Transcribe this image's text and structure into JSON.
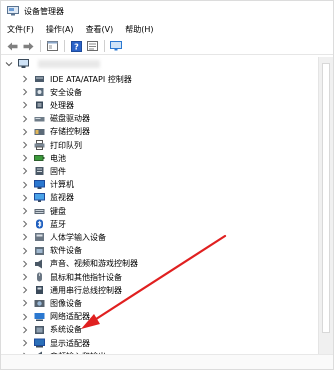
{
  "window": {
    "title": "设备管理器"
  },
  "menu": {
    "items": [
      "文件(F)",
      "操作(A)",
      "查看(V)",
      "帮助(H)"
    ]
  },
  "tree": {
    "items": [
      {
        "label": "IDE ATA/ATAPI 控制器",
        "icon": "ide-controller-icon"
      },
      {
        "label": "安全设备",
        "icon": "security-device-icon"
      },
      {
        "label": "处理器",
        "icon": "processor-icon"
      },
      {
        "label": "磁盘驱动器",
        "icon": "disk-drive-icon"
      },
      {
        "label": "存储控制器",
        "icon": "storage-controller-icon"
      },
      {
        "label": "打印队列",
        "icon": "printer-icon"
      },
      {
        "label": "电池",
        "icon": "battery-icon"
      },
      {
        "label": "固件",
        "icon": "firmware-icon"
      },
      {
        "label": "计算机",
        "icon": "computer-icon"
      },
      {
        "label": "监视器",
        "icon": "monitor-icon"
      },
      {
        "label": "键盘",
        "icon": "keyboard-icon"
      },
      {
        "label": "蓝牙",
        "icon": "bluetooth-icon"
      },
      {
        "label": "人体学输入设备",
        "icon": "hid-icon"
      },
      {
        "label": "软件设备",
        "icon": "software-device-icon"
      },
      {
        "label": "声音、视频和游戏控制器",
        "icon": "sound-icon"
      },
      {
        "label": "鼠标和其他指针设备",
        "icon": "mouse-icon"
      },
      {
        "label": "通用串行总线控制器",
        "icon": "usb-icon"
      },
      {
        "label": "图像设备",
        "icon": "imaging-device-icon"
      },
      {
        "label": "网络适配器",
        "icon": "network-adapter-icon"
      },
      {
        "label": "系统设备",
        "icon": "system-device-icon"
      },
      {
        "label": "显示适配器",
        "icon": "display-adapter-icon"
      },
      {
        "label": "音频输入和输出",
        "icon": "audio-io-icon"
      }
    ]
  },
  "colors": {
    "arrow": "#e02020",
    "icon_blue": "#2b78d0",
    "icon_dark": "#3a4a5a"
  }
}
